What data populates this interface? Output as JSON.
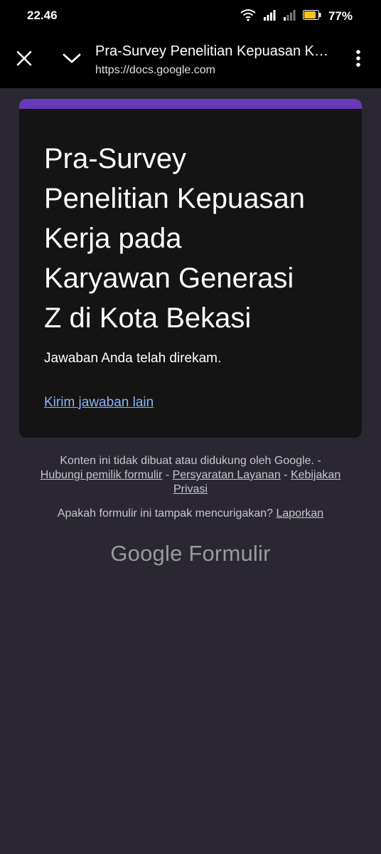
{
  "status_bar": {
    "time": "22.46",
    "battery": "77%",
    "battery_color": "#f5c518"
  },
  "toolbar": {
    "title": "Pra-Survey Penelitian Kepuasan Kerja pada Karyawan Generasi Z di Kota Bekasi",
    "url": "https://docs.google.com",
    "icons": [
      "close-icon",
      "chevron-down-icon",
      "more-vert-icon"
    ]
  },
  "card": {
    "accent_color": "#673ab7",
    "title_lines": [
      "Pra-Survey",
      "Penelitian Kepuasan",
      "Kerja pada",
      "Karyawan Generasi",
      "Z di Kota Bekasi"
    ],
    "confirmation": "Jawaban Anda telah direkam.",
    "another_response": "Kirim jawaban lain"
  },
  "footer": {
    "disclaimer": "Konten ini tidak dibuat atau didukung oleh Google. -",
    "contact_owner": "Hubungi pemilik formulir",
    "sep1": " - ",
    "terms": "Persyaratan Layanan",
    "sep2": " - ",
    "privacy": "Kebijakan Privasi",
    "suspicious": "Apakah formulir ini tampak mencurigakan? ",
    "report": "Laporkan",
    "brand_google": "Google",
    "brand_forms": "Formulir"
  }
}
